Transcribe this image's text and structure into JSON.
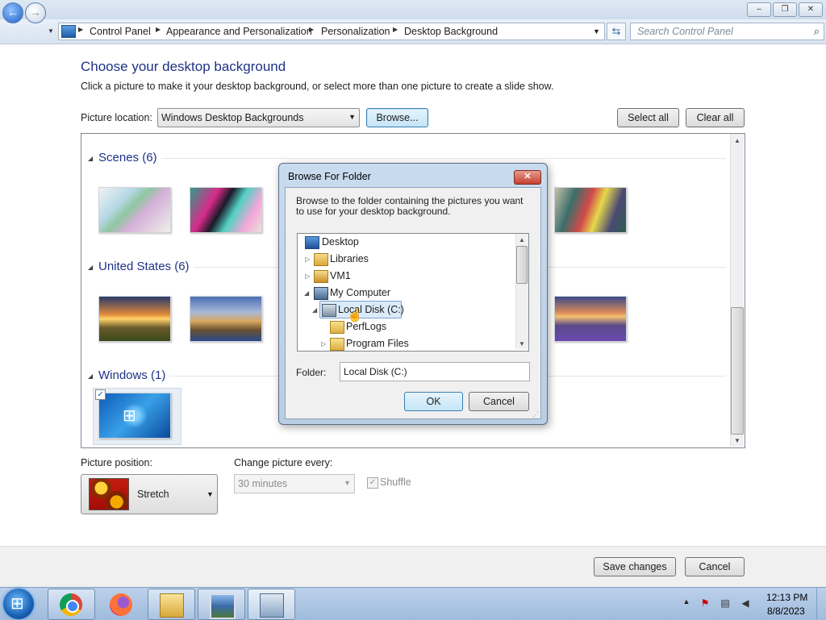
{
  "window": {
    "caption_buttons": {
      "minimize": "–",
      "maximize": "❐",
      "close": "✕"
    }
  },
  "nav": {
    "breadcrumbs": [
      "Control Panel",
      "Appearance and Personalization",
      "Personalization",
      "Desktop Background"
    ],
    "search_placeholder": "Search Control Panel"
  },
  "main": {
    "title": "Choose your desktop background",
    "subtitle": "Click a picture to make it your desktop background, or select more than one picture to create a slide show.",
    "picture_location_label": "Picture location:",
    "picture_location_value": "Windows Desktop Backgrounds",
    "browse_label": "Browse...",
    "select_all_label": "Select all",
    "clear_all_label": "Clear all",
    "groups": [
      {
        "title": "Scenes (6)"
      },
      {
        "title": "United States (6)"
      },
      {
        "title": "Windows (1)"
      }
    ]
  },
  "dialog": {
    "title": "Browse For Folder",
    "message": "Browse to the folder containing the pictures you want to use for your desktop background.",
    "tree": [
      {
        "label": "Desktop",
        "icon": "desktop-icon"
      },
      {
        "label": "Libraries",
        "icon": "libraries-icon"
      },
      {
        "label": "VM1",
        "icon": "user-folder-icon"
      },
      {
        "label": "My Computer",
        "icon": "computer-icon"
      },
      {
        "label": "Local Disk (C:)",
        "icon": "drive-icon",
        "selected": true
      },
      {
        "label": "PerfLogs",
        "icon": "folder-icon"
      },
      {
        "label": "Program Files",
        "icon": "folder-icon"
      }
    ],
    "folder_label": "Folder:",
    "folder_value": "Local Disk (C:)",
    "ok_label": "OK",
    "cancel_label": "Cancel"
  },
  "bottom": {
    "picture_position_label": "Picture position:",
    "picture_position_value": "Stretch",
    "change_every_label": "Change picture every:",
    "change_every_value": "30 minutes",
    "shuffle_label": "Shuffle",
    "save_label": "Save changes",
    "cancel_label": "Cancel"
  },
  "taskbar": {
    "apps": [
      "Chrome",
      "Firefox",
      "Windows Explorer",
      "Photos",
      "Control Panel"
    ],
    "time": "12:13 PM",
    "date": "8/8/2023"
  },
  "colors": {
    "heading": "#1e3287",
    "selection": "#dbeaf8",
    "taskbar": "#a9c3e1"
  }
}
